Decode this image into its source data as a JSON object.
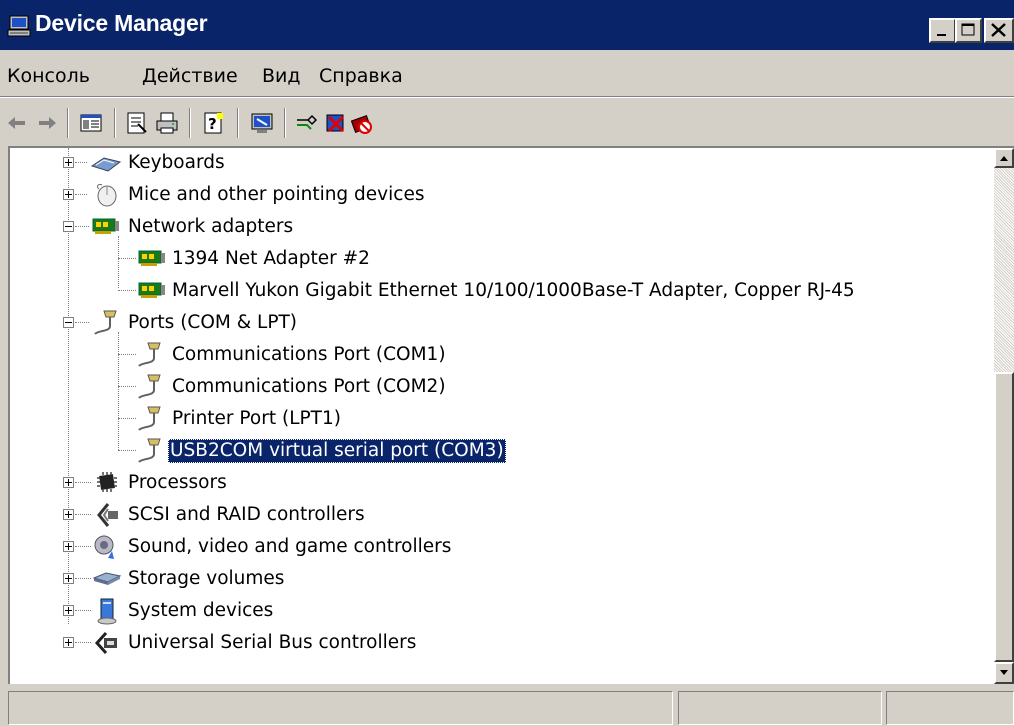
{
  "window": {
    "title": "Device Manager",
    "buttons": {
      "minimize": "_",
      "maximize": "□",
      "close": "X"
    }
  },
  "menu": {
    "items": [
      "Консоль",
      "Действие",
      "Вид",
      "Справка"
    ]
  },
  "toolbar": {
    "icons": [
      "back-arrow-icon",
      "forward-arrow-icon",
      "show-hide-tree-icon",
      "properties-icon",
      "print-icon",
      "help-icon",
      "scan-hardware-icon",
      "update-driver-icon",
      "uninstall-icon",
      "disable-device-icon"
    ]
  },
  "tree": {
    "items": [
      {
        "label": "Keyboards",
        "icon": "keyboard-icon",
        "level": 0,
        "expanded": false
      },
      {
        "label": "Mice and other pointing devices",
        "icon": "mouse-icon",
        "level": 0,
        "expanded": false
      },
      {
        "label": "Network adapters",
        "icon": "network-adapter-icon",
        "level": 0,
        "expanded": true
      },
      {
        "label": "1394 Net Adapter #2",
        "icon": "network-adapter-icon",
        "level": 1
      },
      {
        "label": "Marvell Yukon Gigabit Ethernet 10/100/1000Base-T Adapter, Copper RJ-45",
        "icon": "network-adapter-icon",
        "level": 1
      },
      {
        "label": "Ports (COM & LPT)",
        "icon": "port-icon",
        "level": 0,
        "expanded": true
      },
      {
        "label": "Communications Port (COM1)",
        "icon": "port-icon",
        "level": 1
      },
      {
        "label": "Communications Port (COM2)",
        "icon": "port-icon",
        "level": 1
      },
      {
        "label": "Printer Port (LPT1)",
        "icon": "port-icon",
        "level": 1
      },
      {
        "label": "USB2COM virtual serial port (COM3)",
        "icon": "port-icon",
        "level": 1,
        "selected": true
      },
      {
        "label": "Processors",
        "icon": "processor-icon",
        "level": 0,
        "expanded": false
      },
      {
        "label": "SCSI and RAID controllers",
        "icon": "scsi-icon",
        "level": 0,
        "expanded": false
      },
      {
        "label": "Sound, video and game controllers",
        "icon": "sound-icon",
        "level": 0,
        "expanded": false
      },
      {
        "label": "Storage volumes",
        "icon": "storage-volume-icon",
        "level": 0,
        "expanded": false
      },
      {
        "label": "System devices",
        "icon": "system-device-icon",
        "level": 0,
        "expanded": false
      },
      {
        "label": "Universal Serial Bus controllers",
        "icon": "usb-icon",
        "level": 0,
        "expanded": false
      }
    ]
  },
  "colors": {
    "titlebar": "#0a246a",
    "selection": "#0a246a",
    "chrome": "#d4d0c8"
  }
}
